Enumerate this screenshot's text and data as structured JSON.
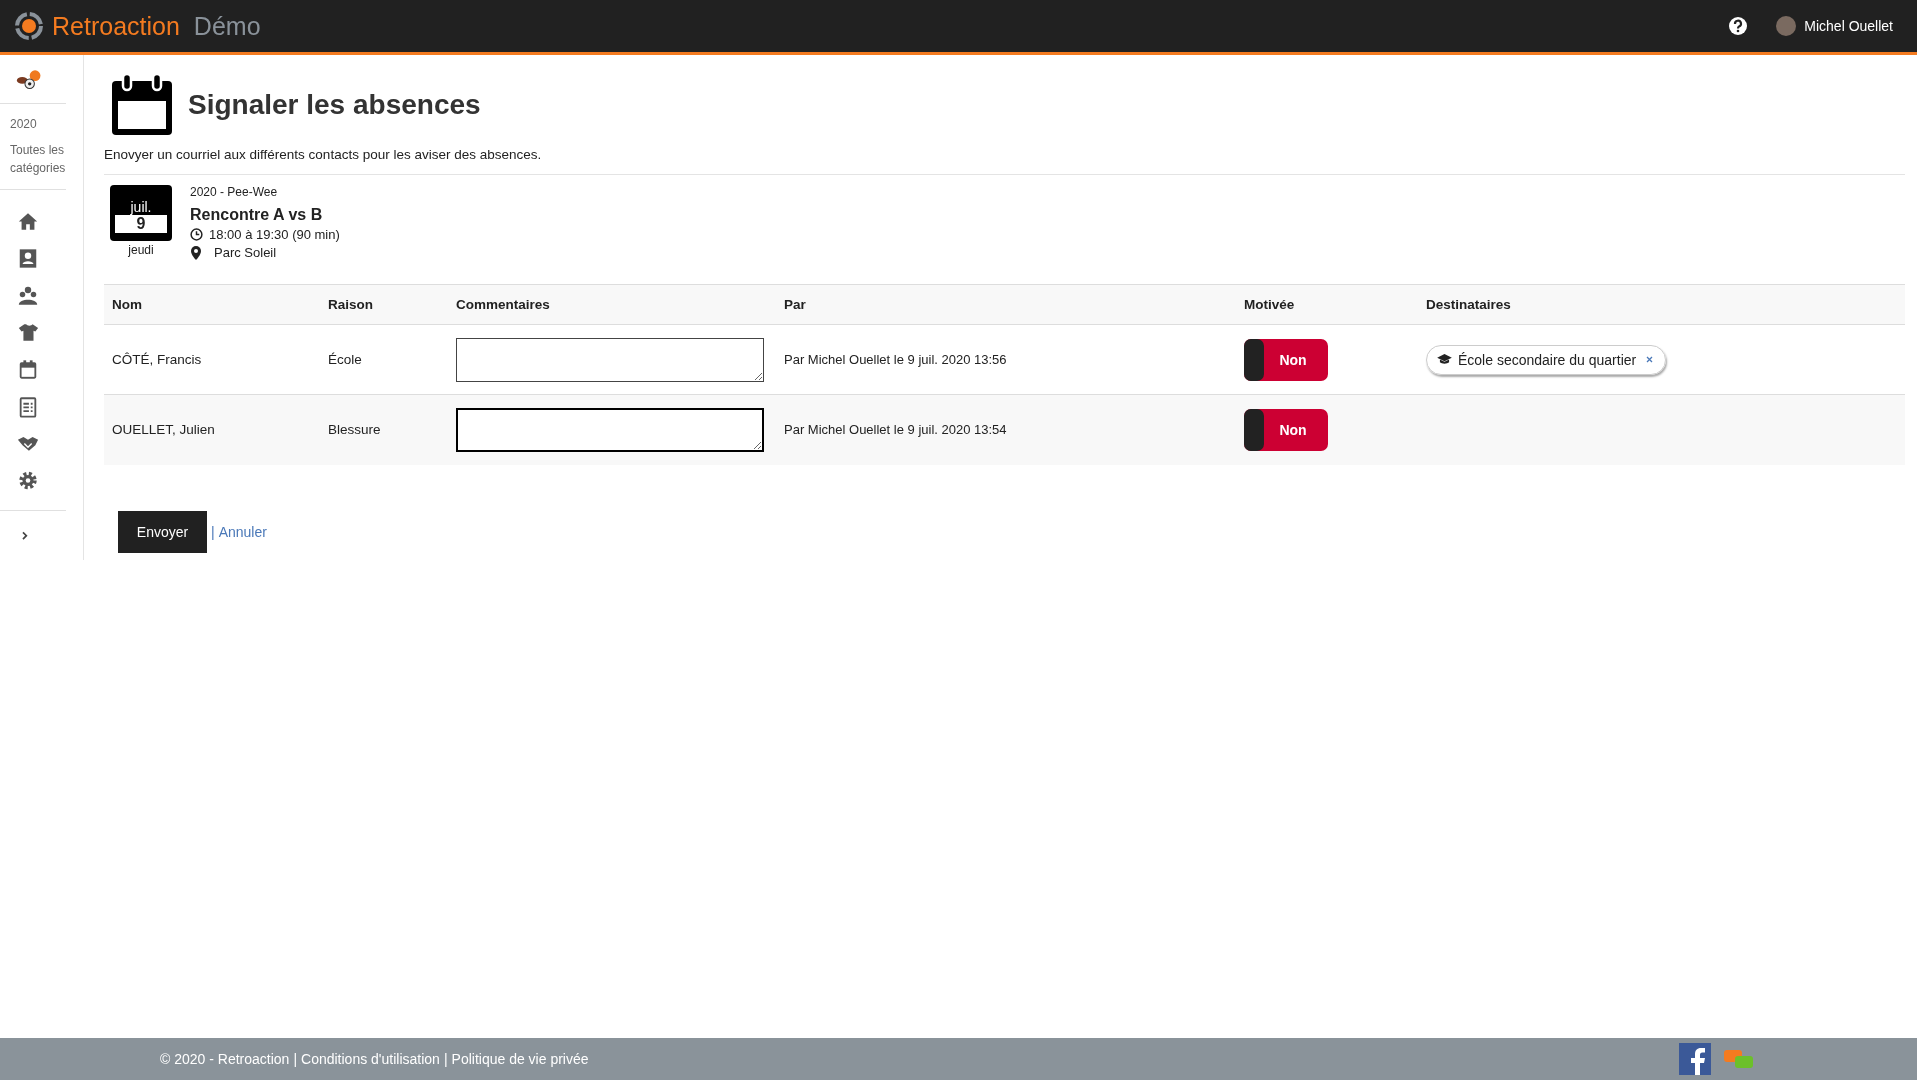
{
  "header": {
    "brand": "Retroaction",
    "subtitle": "Démo",
    "user": "Michel Ouellet"
  },
  "sidebar": {
    "year": "2020",
    "category": "Toutes les catégories",
    "items": [
      {
        "kind": "home"
      },
      {
        "kind": "contact"
      },
      {
        "kind": "people"
      },
      {
        "kind": "shirt"
      },
      {
        "kind": "calendar"
      },
      {
        "kind": "checklist"
      },
      {
        "kind": "handshake"
      },
      {
        "kind": "settings"
      }
    ]
  },
  "page": {
    "title": "Signaler les absences",
    "description": "Enovyer un courriel aux différents contacts pour les aviser des absences."
  },
  "event": {
    "month": "juil.",
    "day": "9",
    "weekday": "jeudi",
    "category": "2020 - Pee-Wee",
    "title": "Rencontre A vs B",
    "time": "18:00 à 19:30 (90 min)",
    "place": "Parc Soleil"
  },
  "table": {
    "columns": [
      "Nom",
      "Raison",
      "Commentaires",
      "Par",
      "Motivée",
      "Destinataires"
    ],
    "rows": [
      {
        "name": "CÔTÉ, Francis",
        "reason": "École",
        "comment": "",
        "focused": false,
        "by": "Par Michel Ouellet le 9 juil. 2020 13:56",
        "motivated": {
          "on": false,
          "label": "Non"
        },
        "recipients": [
          "École secondaire du quartier"
        ]
      },
      {
        "name": "OUELLET, Julien",
        "reason": "Blessure",
        "comment": "",
        "focused": true,
        "by": "Par Michel Ouellet le 9 juil. 2020 13:54",
        "motivated": {
          "on": false,
          "label": "Non"
        },
        "recipients": []
      }
    ]
  },
  "actions": {
    "submit": "Envoyer",
    "separator": "|",
    "cancel": "Annuler"
  },
  "footer": {
    "copyright": "© 2020 - Retroaction",
    "links": [
      "Conditions d'utilisation",
      "Politique de vie privée"
    ],
    "separator": "|"
  }
}
